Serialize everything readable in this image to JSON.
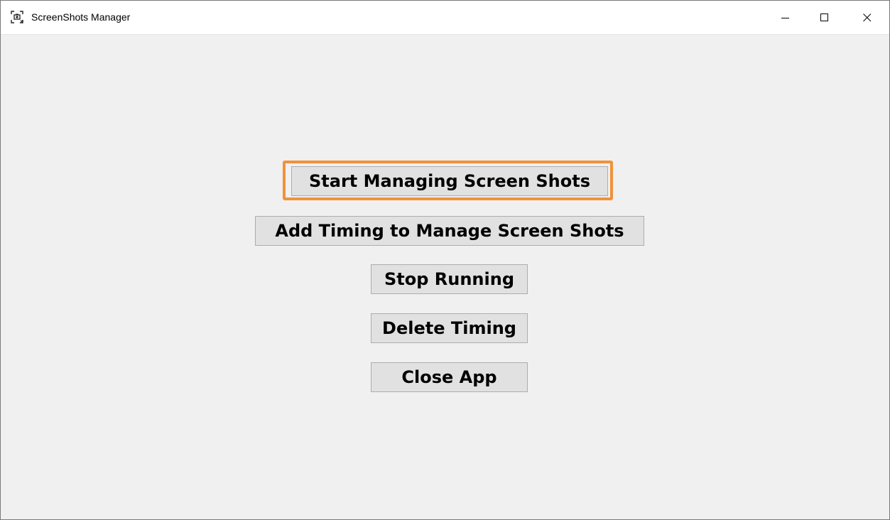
{
  "window": {
    "title": "ScreenShots Manager",
    "icon": "screenshot-app-icon",
    "controls": {
      "minimize": "minimize-icon",
      "maximize": "maximize-icon",
      "close": "close-icon"
    }
  },
  "buttons": {
    "start": "Start Managing Screen Shots",
    "add_timing": "Add Timing to Manage Screen Shots",
    "stop": "Stop Running",
    "delete_timing": "Delete Timing",
    "close_app": "Close App"
  },
  "colors": {
    "highlight": "#f0923a",
    "background": "#f0f0f0",
    "button_face": "#e1e1e1"
  }
}
